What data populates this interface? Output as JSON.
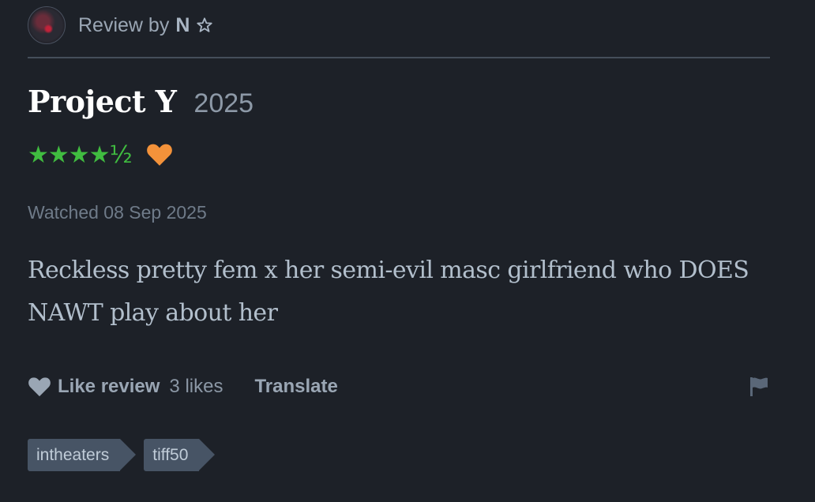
{
  "header": {
    "review_by_label": "Review by",
    "reviewer_name": "N",
    "avatar_icon": "avatar-image",
    "patron_icon": "star-outline-icon"
  },
  "film": {
    "title": "Project Y",
    "year": "2025"
  },
  "rating": {
    "stars_text": "★★★★½",
    "value": 4.5,
    "max": 5,
    "liked": true,
    "star_color": "#40bc40",
    "heart_color": "#f3923a"
  },
  "watched_text": "Watched 08 Sep 2025",
  "review": {
    "body": "Reckless pretty fem x her semi-evil masc girlfriend who DOES NAWT play about her"
  },
  "actions": {
    "like_label": "Like review",
    "like_count": "3 likes",
    "translate_label": "Translate",
    "report_icon": "flag-icon"
  },
  "tags": [
    {
      "label": "intheaters"
    },
    {
      "label": "tiff50"
    }
  ]
}
